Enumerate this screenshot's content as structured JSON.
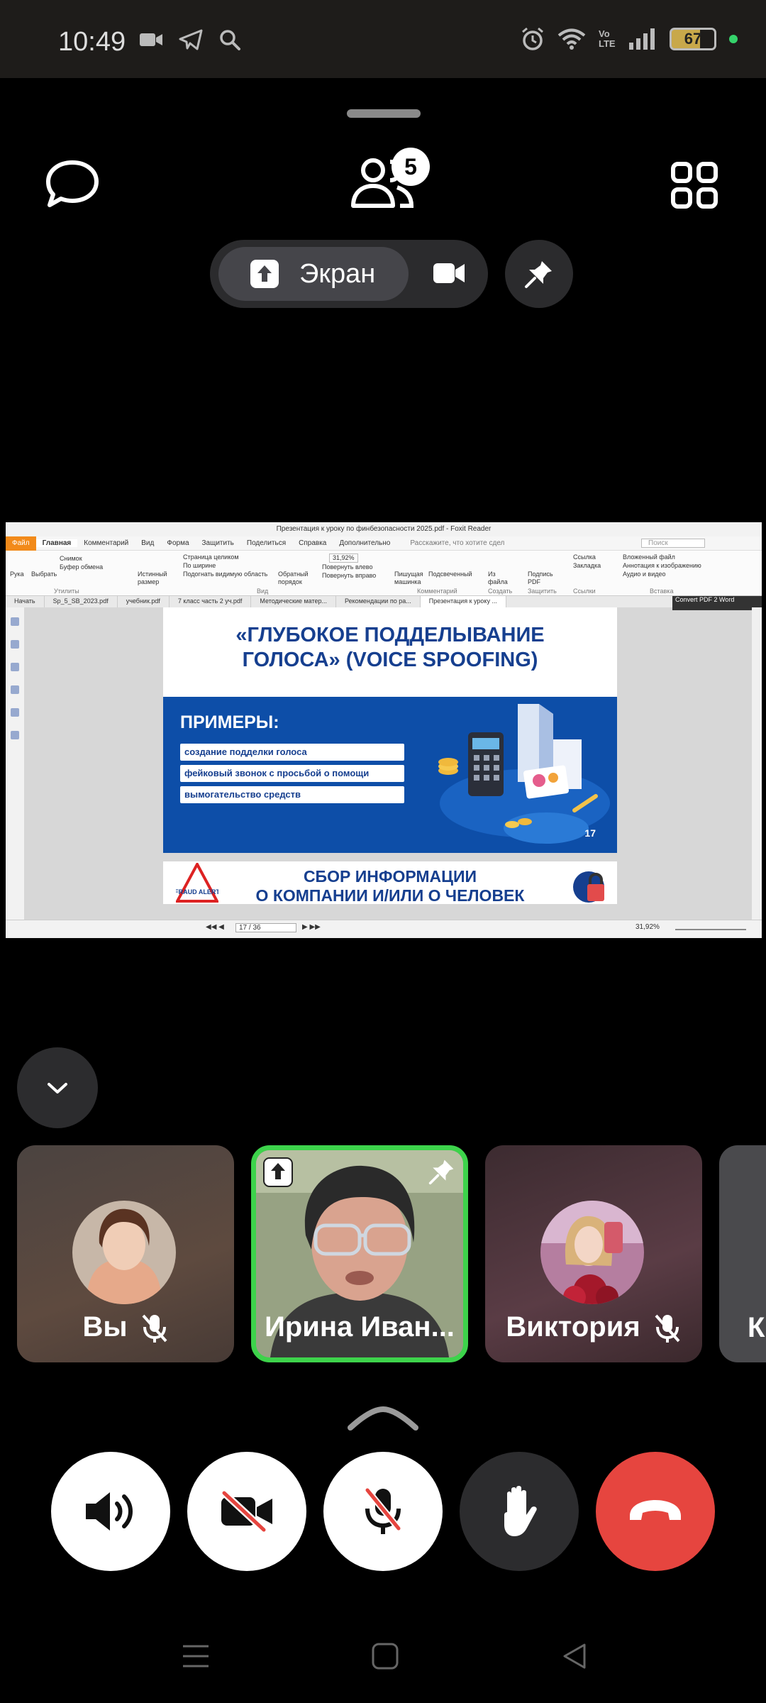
{
  "status_bar": {
    "time": "10:49",
    "battery": "67",
    "network_label": "Vo LTE",
    "icons_left": [
      "video-notification-icon",
      "telegram-icon",
      "search-icon"
    ],
    "icons_right": [
      "alarm-icon",
      "wifi-icon",
      "volte-icon",
      "signal-icon",
      "battery-icon"
    ]
  },
  "call_header": {
    "participants_count": "5",
    "share_label": "Экран"
  },
  "shared_screen": {
    "window_title": "Презентация к уроку по финбезопасности 2025.pdf - Foxit Reader",
    "menu": [
      "Файл",
      "Главная",
      "Комментарий",
      "Вид",
      "Форма",
      "Защитить",
      "Поделиться",
      "Справка",
      "Дополнительно"
    ],
    "tell_me": "Расскажите, что хотите сдел",
    "search_placeholder": "Поиск",
    "ribbon": {
      "hand": "Рука",
      "select": "Выбрать",
      "snapshot": "Снимок",
      "clipboard": "Буфер обмена",
      "utilities": "Утилиты",
      "actual_size": "Истинный размер",
      "fit_page": "Страница целиком",
      "fit_width": "По ширине",
      "fit_visible": "Подогнать видимую область",
      "reverse": "Обратный порядок",
      "zoom": "31,92%",
      "rotate_left": "Повернуть влево",
      "rotate_right": "Повернуть вправо",
      "view": "Вид",
      "typewriter": "Пишущая машинка",
      "highlight": "Подсвеченный",
      "comment": "Комментарий",
      "from_file": "Из файла",
      "create": "Создать",
      "sign_pdf": "Подпись PDF",
      "protect": "Защитить",
      "link": "Ссылка",
      "bookmark": "Закладка",
      "links": "Ссылки",
      "attached_file": "Вложенный файл",
      "image_annotation": "Аннотация к изображению",
      "audio_video": "Аудио и видео",
      "insert": "Вставка"
    },
    "tabs": [
      "Начать",
      "Sp_5_SB_2023.pdf",
      "учебник.pdf",
      "7 класс часть 2 уч.pdf",
      "Методические матер...",
      "Рекомендации по ра...",
      "Презентация к уроку ..."
    ],
    "convert": "Convert PDF 2 Word",
    "slide1": {
      "title_line1": "«ГЛУБОКОЕ ПОДДЕЛЫВАНИЕ",
      "title_line2": "ГОЛОСА» (VOICE SPOOFING)",
      "heading": "ПРИМЕРЫ:",
      "items": [
        "создание подделки голоса",
        "фейковый звонок с просьбой о помощи",
        "вымогательство средств"
      ],
      "page_number": "17"
    },
    "slide2": {
      "title_line1": "СБОР ИНФОРМАЦИИ",
      "title_line2": "О КОМПАНИИ И/ИЛИ О ЧЕЛОВЕК",
      "badge": "FRAUD ALERT"
    },
    "status": {
      "page_indicator": "17 / 36",
      "zoom": "31,92%"
    }
  },
  "participants": [
    {
      "name": "Вы",
      "muted": true
    },
    {
      "name": "Ирина Иван...",
      "sharing": true,
      "pinned": true,
      "speaking": true
    },
    {
      "name": "Виктория",
      "muted": true
    },
    {
      "name": "К"
    }
  ],
  "controls": [
    "speaker",
    "camera-off",
    "mic-off",
    "raise-hand",
    "end-call"
  ],
  "colors": {
    "speaking_border": "#3dd34b",
    "end_call": "#e6453f",
    "slide_blue": "#0d4ea8"
  }
}
